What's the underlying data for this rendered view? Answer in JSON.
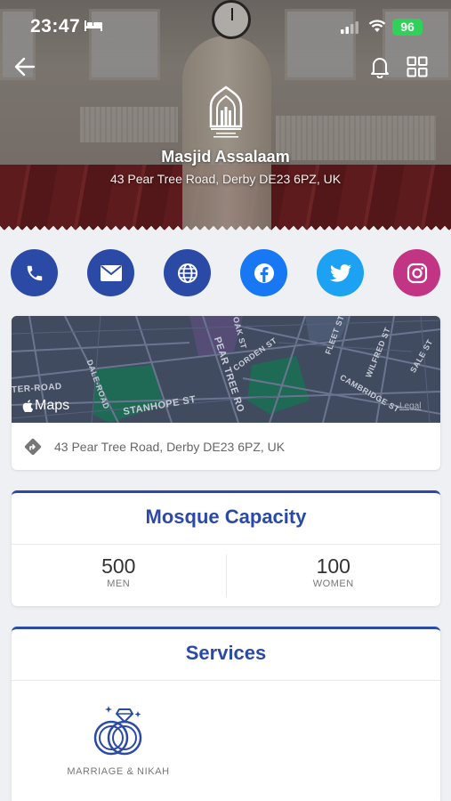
{
  "status_bar": {
    "time": "23:47",
    "battery": "96"
  },
  "mosque": {
    "name": "Masjid Assalaam",
    "address": "43 Pear Tree Road, Derby DE23 6PZ, UK"
  },
  "contacts": [
    {
      "name": "phone",
      "color": "#2b4aa6"
    },
    {
      "name": "email",
      "color": "#2b4aa6"
    },
    {
      "name": "website",
      "color": "#2b4aa6"
    },
    {
      "name": "facebook",
      "color": "#1877f2"
    },
    {
      "name": "twitter",
      "color": "#1da1f2"
    },
    {
      "name": "instagram",
      "color": "#c13584"
    }
  ],
  "map": {
    "provider": "Maps",
    "legal": "Legal",
    "streets": [
      "TER-ROAD",
      "DALE-ROAD",
      "STANHOPE ST",
      "PEAR TREE RO",
      "OAK ST",
      "CORDEN ST",
      "FLEET ST",
      "WILFRED ST",
      "SALE ST",
      "CAMBRIDGE ST"
    ],
    "address": "43 Pear Tree Road, Derby DE23 6PZ, UK"
  },
  "capacity": {
    "title": "Mosque Capacity",
    "men_value": "500",
    "men_label": "MEN",
    "women_value": "100",
    "women_label": "WOMEN"
  },
  "services": {
    "title": "Services",
    "items": [
      {
        "label": "MARRIAGE & NIKAH",
        "icon": "rings-icon"
      }
    ]
  },
  "colors": {
    "accent": "#2b4aa6",
    "background": "#eef0f3"
  }
}
